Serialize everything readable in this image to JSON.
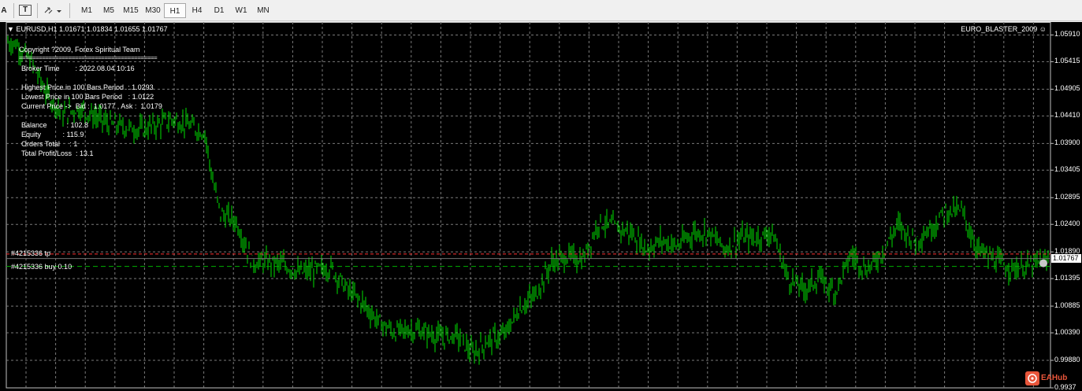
{
  "toolbar": {
    "text_tool": "A",
    "label_tool": "T",
    "timeframes": [
      "M1",
      "M5",
      "M15",
      "M30",
      "H1",
      "H4",
      "D1",
      "W1",
      "MN"
    ],
    "active_timeframe": "H1"
  },
  "chart": {
    "header": "EURUSD,H1  1.01671 1.01834 1.01655 1.01767",
    "expert_name": "EURO_BLASTER_2009",
    "info_lines": [
      "Copyright ?2009, Forex Spiritual Team",
      "==========================================",
      "Broker Time        : 2022.08.04 10:16",
      "Highest Price in 100 Bars Period  : 1.0293",
      "Lowest Price in 100 Bars Period   : 1.0122",
      "Current Price ->  Bid :  1.0177 , Ask :  1.0179",
      "Balance          : 102.8",
      "Equity           : 115.9",
      "Orders Total     : 1",
      "Total Profit/Loss  : 13.1"
    ],
    "order_tp_label": "#4215336 tp",
    "order_buy_label": "#4215336 buy 0.10",
    "price_axis": [
      "1.05910",
      "1.05415",
      "1.04905",
      "1.04410",
      "1.03900",
      "1.03405",
      "1.02895",
      "1.02400",
      "1.01890",
      "1.01395",
      "1.00885",
      "1.00390",
      "0.99880",
      "0.9937"
    ],
    "current_price": "1.01767",
    "watermark": "EAHub",
    "colors": {
      "background": "#000000",
      "candles": "#00e000",
      "grid": "#7a7a7a",
      "tp_line": "#ff3030",
      "buy_line": "#00b000",
      "current_price_box": "#ffffff"
    }
  },
  "chart_data": {
    "type": "line",
    "title": "EURUSD,H1",
    "ylim": [
      0.9937,
      1.0615
    ],
    "x": [
      "1",
      "20",
      "40",
      "60",
      "80",
      "100",
      "140",
      "180",
      "220",
      "260",
      "270",
      "280",
      "300",
      "320",
      "340",
      "360",
      "380",
      "420",
      "440",
      "460",
      "480",
      "500",
      "520",
      "540",
      "560",
      "580",
      "600",
      "620",
      "640",
      "660",
      "680",
      "700",
      "720",
      "740",
      "760",
      "780",
      "800",
      "820",
      "840",
      "860",
      "880",
      "900",
      "920",
      "940",
      "960",
      "980",
      "1000",
      "1020",
      "1040",
      "1060",
      "1080",
      "1100",
      "1120",
      "1140",
      "1160",
      "1180",
      "1200",
      "1220",
      "1240",
      "1260",
      "1280",
      "1300",
      "1320"
    ],
    "series": [
      {
        "values": [
          1.058,
          1.0575,
          1.054,
          1.048,
          1.0445,
          1.0455,
          1.0425,
          1.0415,
          1.0435,
          1.041,
          1.032,
          1.026,
          1.0245,
          1.017,
          1.017,
          1.0165,
          1.015,
          1.016,
          1.012,
          1.0095,
          1.006,
          1.004,
          1.0045,
          1.004,
          1.003,
          1.0035,
          1.0,
          1.0025,
          1.0035,
          1.0085,
          1.011,
          1.017,
          1.018,
          1.0175,
          1.0245,
          1.0235,
          1.0225,
          1.0195,
          1.021,
          1.02,
          1.0225,
          1.0225,
          1.0195,
          1.0215,
          1.0215,
          1.0225,
          1.014,
          1.012,
          1.014,
          1.0115,
          1.0185,
          1.0155,
          1.019,
          1.024,
          1.021,
          1.023,
          1.0265,
          1.0265,
          1.0195,
          1.0175,
          1.016,
          1.016,
          1.017
        ]
      }
    ]
  }
}
